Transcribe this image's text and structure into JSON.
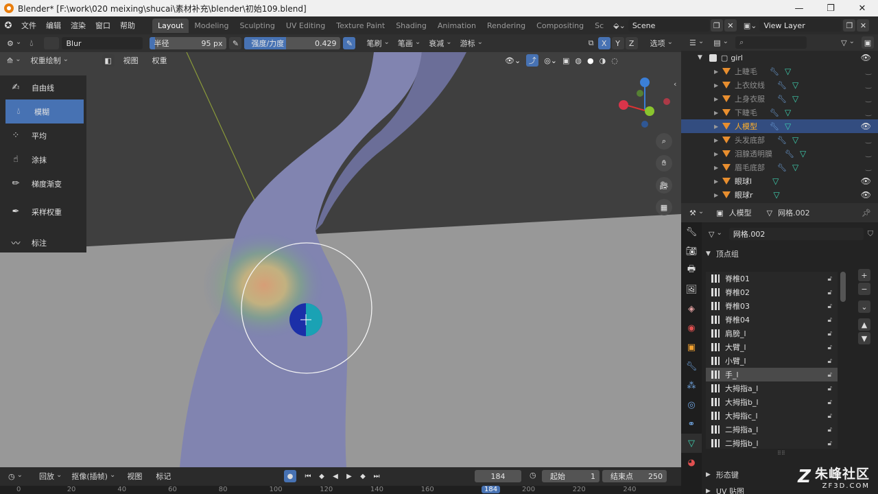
{
  "window": {
    "title": "Blender* [F:\\work\\020 meixing\\shucai\\素材补充\\blender\\初始109.blend]",
    "controls": [
      "—",
      "❐",
      "✕"
    ]
  },
  "menu": {
    "items": [
      "文件",
      "编辑",
      "渲染",
      "窗口",
      "帮助"
    ],
    "workspaces": [
      "Layout",
      "Modeling",
      "Sculpting",
      "UV Editing",
      "Texture Paint",
      "Shading",
      "Animation",
      "Rendering",
      "Compositing",
      "Sc"
    ],
    "active_workspace": "Layout",
    "scene": "Scene",
    "view_layer": "View Layer"
  },
  "tool_header": {
    "brush_name": "Blur",
    "radius_label": "半径",
    "radius_value": "95 px",
    "strength_label": "强度/力度",
    "strength_value": "0.429",
    "strength_fraction": 0.429,
    "dropdowns": [
      "笔刷",
      "笔画",
      "衰减",
      "游标"
    ],
    "axes": [
      "X",
      "Y",
      "Z"
    ],
    "options": "选项"
  },
  "viewport_header": {
    "mode": "权重绘制",
    "menus": [
      "视图",
      "权重"
    ]
  },
  "tools": [
    {
      "label": "自由线",
      "icon": "brush-line-icon",
      "active": false
    },
    {
      "label": "模糊",
      "icon": "drop-icon",
      "active": true
    },
    {
      "label": "平均",
      "icon": "average-icon",
      "active": false
    },
    {
      "label": "涂抹",
      "icon": "smear-icon",
      "active": false
    },
    {
      "label": "梯度渐变",
      "icon": "gradient-icon",
      "active": false
    },
    {
      "label": "采样权重",
      "icon": "eyedropper-icon",
      "active": false
    },
    {
      "label": "标注",
      "icon": "annotate-icon",
      "active": false
    }
  ],
  "outliner": {
    "collection": "girl",
    "items": [
      {
        "name": "上睫毛",
        "selected": false,
        "visible": false
      },
      {
        "name": "上衣纹线",
        "selected": false,
        "visible": false
      },
      {
        "name": "上身衣服",
        "selected": false,
        "visible": false
      },
      {
        "name": "下睫毛",
        "selected": false,
        "visible": false
      },
      {
        "name": "人模型",
        "selected": true,
        "visible": true
      },
      {
        "name": "头发底部",
        "selected": false,
        "visible": false
      },
      {
        "name": "泪腺透明膜",
        "selected": false,
        "visible": false
      },
      {
        "name": "眉毛底部",
        "selected": false,
        "visible": false
      },
      {
        "name": "眼球l",
        "selected": false,
        "visible": true
      },
      {
        "name": "眼球r",
        "selected": false,
        "visible": true
      }
    ]
  },
  "properties": {
    "object_name": "人模型",
    "mesh_name": "网格.002",
    "data_field": "网格.002",
    "section_vertex_groups": "顶点组",
    "vertex_groups": [
      "脊椎01",
      "脊椎02",
      "脊椎03",
      "脊椎04",
      "肩膀_l",
      "大臂_l",
      "小臂_l",
      "手_l",
      "大拇指a_l",
      "大拇指b_l",
      "大拇指c_l",
      "二拇指a_l",
      "二拇指b_l"
    ],
    "selected_group": "手_l",
    "section_shape_keys": "形态键",
    "section_uv": "UV 贴图"
  },
  "timeline": {
    "playback": "回放",
    "keying": "抠像(插帧)",
    "view": "视图",
    "marker": "标记",
    "current_frame": "184",
    "start_label": "起始",
    "start_value": "1",
    "end_label": "结束点",
    "end_value": "250",
    "ruler": [
      "0",
      "20",
      "40",
      "60",
      "80",
      "100",
      "120",
      "140",
      "160",
      "184",
      "200",
      "220",
      "240"
    ],
    "ruler_highlight": "184"
  },
  "watermark": {
    "text": "朱峰社区",
    "url": "ZF3D.COM"
  }
}
